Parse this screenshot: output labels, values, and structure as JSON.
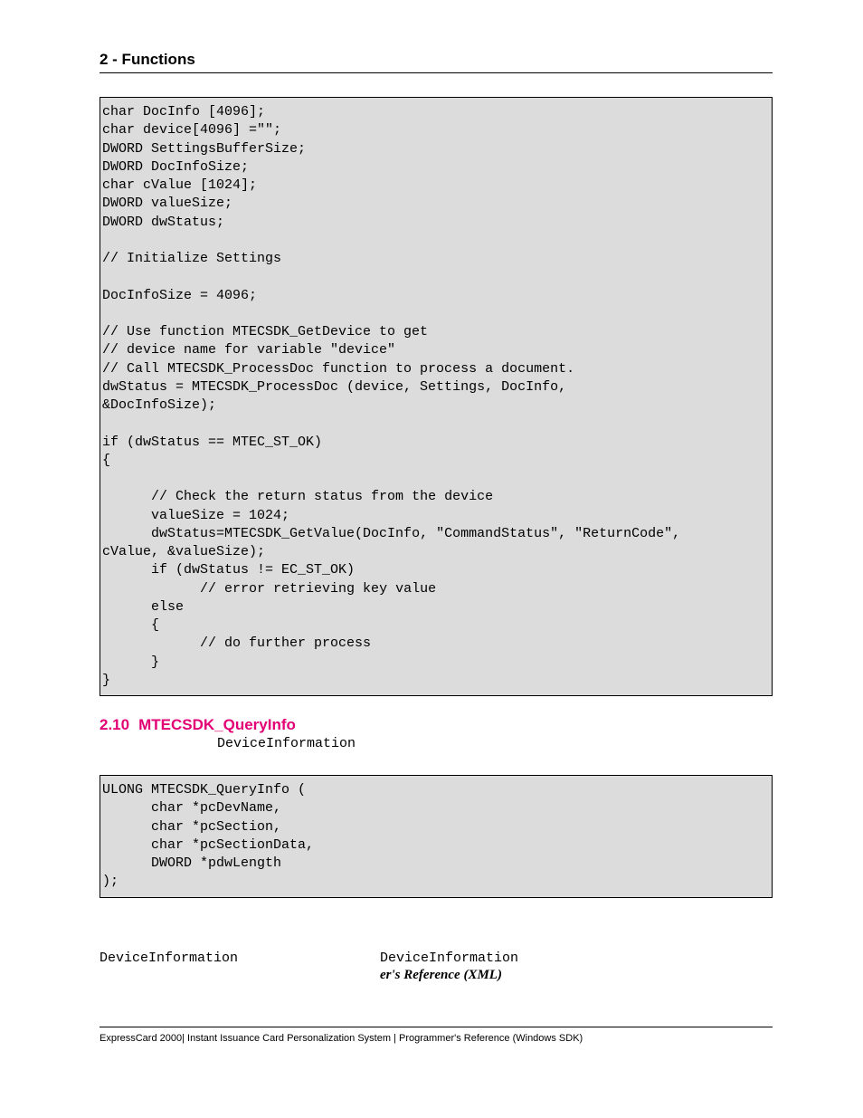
{
  "header": {
    "section_label": "2 - Functions"
  },
  "code_example": "char DocInfo [4096];\nchar device[4096] =\"\";\nDWORD SettingsBufferSize;\nDWORD DocInfoSize;\nchar cValue [1024];\nDWORD valueSize;\nDWORD dwStatus;\n\n// Initialize Settings\n\nDocInfoSize = 4096;\n\n// Use function MTECSDK_GetDevice to get\n// device name for variable \"device\"\n// Call MTECSDK_ProcessDoc function to process a document.\ndwStatus = MTECSDK_ProcessDoc (device, Settings, DocInfo,\n&DocInfoSize);\n\nif (dwStatus == MTEC_ST_OK)\n{\n\n      // Check the return status from the device\n      valueSize = 1024;\n      dwStatus=MTECSDK_GetValue(DocInfo, \"CommandStatus\", \"ReturnCode\",\ncValue, &valueSize);\n      if (dwStatus != EC_ST_OK)\n            // error retrieving key value\n      else\n      {\n            // do further process\n      }\n}",
  "subsection": {
    "number": "2.10",
    "title": "MTECSDK_QueryInfo",
    "intro_identifier": "DeviceInformation"
  },
  "signature": "ULONG MTECSDK_QueryInfo (\n      char *pcDevName,\n      char *pcSection,\n      char *pcSectionData,\n      DWORD *pdwLength\n);",
  "devinfo": {
    "left": "DeviceInformation",
    "right": "DeviceInformation"
  },
  "ref_line": "er's Reference (XML)",
  "footer": "ExpressCard 2000| Instant Issuance Card Personalization System | Programmer's Reference (Windows SDK)"
}
